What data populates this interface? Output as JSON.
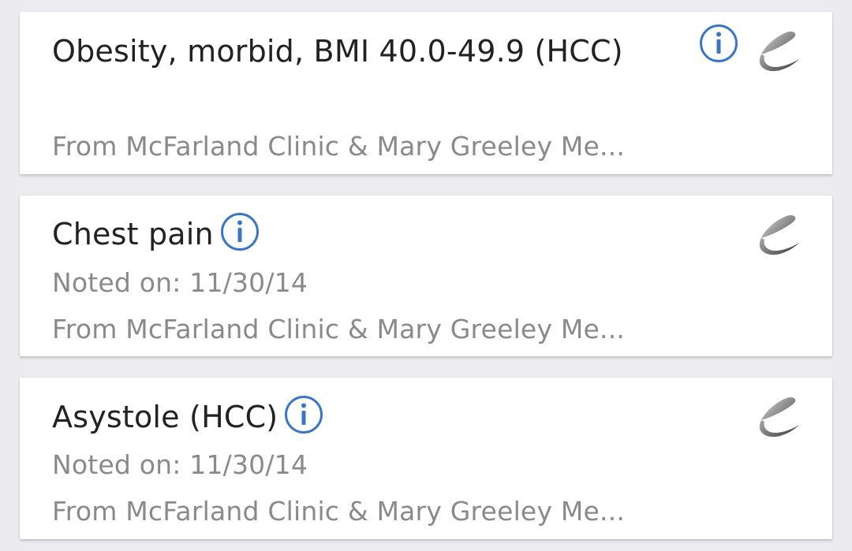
{
  "problems": [
    {
      "title": "Obesity, morbid, BMI 40.0-49.9 (HCC)",
      "noted": "",
      "source": "From McFarland Clinic & Mary Greeley Me..."
    },
    {
      "title": "Chest pain",
      "noted": "Noted on: 11/30/14",
      "source": "From McFarland Clinic & Mary Greeley Me..."
    },
    {
      "title": "Asystole (HCC)",
      "noted": "Noted on: 11/30/14",
      "source": "From McFarland Clinic & Mary Greeley Me..."
    }
  ],
  "icons": {
    "info": "info-icon",
    "source_logo": "epic-logo-icon"
  },
  "colors": {
    "info_blue": "#3b76c4",
    "background": "#ebebf0",
    "secondary_text": "#8a8a8a"
  }
}
